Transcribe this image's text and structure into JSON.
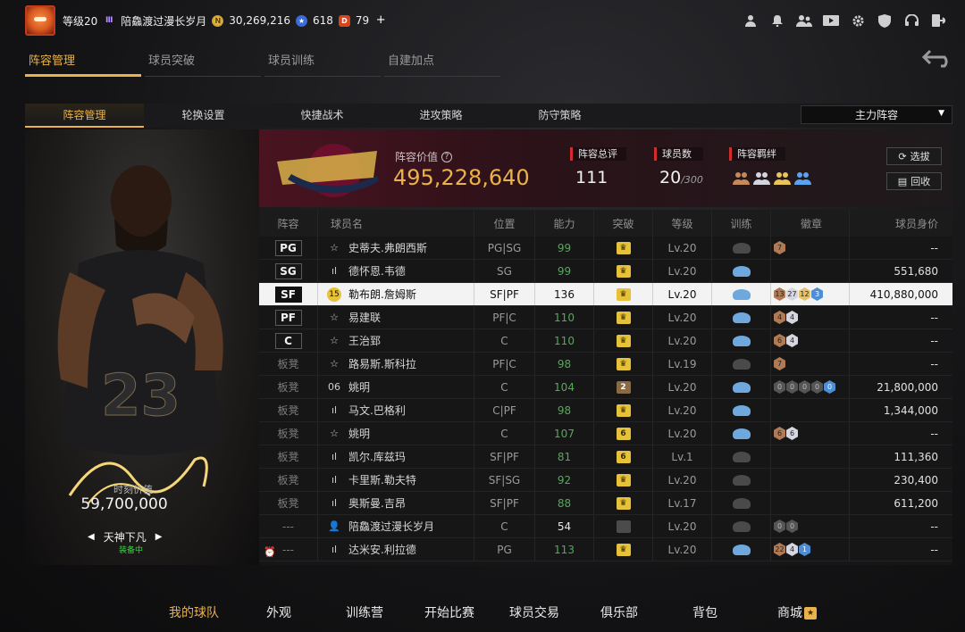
{
  "topbar": {
    "level": "等级20",
    "rank_icon": "Ⅲ",
    "player_name": "陪鱻渡过漫长岁月",
    "coins": "30,269,216",
    "stars": "618",
    "tickets": "79",
    "add_label": "+",
    "icons": [
      "user-icon",
      "bell-icon",
      "friends-icon",
      "video-icon",
      "gear-icon",
      "shield-icon",
      "headset-icon",
      "exit-icon"
    ]
  },
  "section_tabs": [
    {
      "label": "阵容管理",
      "active": true
    },
    {
      "label": "球员突破",
      "active": false
    },
    {
      "label": "球员训练",
      "active": false
    },
    {
      "label": "自建加点",
      "active": false
    }
  ],
  "sub_tabs": [
    {
      "label": "阵容管理",
      "active": true
    },
    {
      "label": "轮换设置",
      "active": false
    },
    {
      "label": "快捷战术",
      "active": false
    },
    {
      "label": "进攻策略",
      "active": false
    },
    {
      "label": "防守策略",
      "active": false
    }
  ],
  "lineup_select": {
    "value": "主力阵容"
  },
  "card": {
    "value_label": "时刻价值",
    "value": "59,700,000",
    "name": "天神下凡",
    "status": "装备中"
  },
  "team": {
    "logo_text": "CAVALIERS",
    "value_label": "阵容价值",
    "value": "495,228,640",
    "rating_label": "阵容总评",
    "rating": "111",
    "count_label": "球员数",
    "count": "20",
    "count_max": "/300",
    "bond_label": "阵容羁绊",
    "select_button": "选拔",
    "recycle_button": "回收"
  },
  "table": {
    "headers": {
      "pos": "阵容",
      "name": "球员名",
      "role": "位置",
      "ovr": "能力",
      "brk": "突破",
      "lv": "等级",
      "train": "训练",
      "badges": "徽章",
      "price": "球员身价"
    },
    "rows": [
      {
        "pos": "PG",
        "starter": true,
        "icon": "☆",
        "name": "史蒂夫.弗朗西斯",
        "role": "PG|SG",
        "ovr": "99",
        "brk": "gold",
        "lv": "Lv.20",
        "train": "gray",
        "badges": [
          [
            "bronze",
            "7"
          ]
        ],
        "price": "--"
      },
      {
        "pos": "SG",
        "starter": true,
        "icon": "ıl",
        "name": "德怀恩.韦德",
        "role": "SG",
        "ovr": "99",
        "brk": "gold",
        "lv": "Lv.20",
        "train": "blue",
        "badges": [],
        "price": "551,680"
      },
      {
        "pos": "SF",
        "starter": true,
        "icon": "15",
        "name": "勒布朗.詹姆斯",
        "role": "SF|PF",
        "ovr": "136",
        "brk": "gold",
        "lv": "Lv.20",
        "train": "blue",
        "badges": [
          [
            "bronze",
            "13"
          ],
          [
            "silver",
            "27"
          ],
          [
            "gold",
            "12"
          ],
          [
            "blue",
            "3"
          ]
        ],
        "price": "410,880,000",
        "selected": true
      },
      {
        "pos": "PF",
        "starter": true,
        "icon": "☆",
        "name": "易建联",
        "role": "PF|C",
        "ovr": "110",
        "brk": "gold",
        "lv": "Lv.20",
        "train": "blue",
        "badges": [
          [
            "bronze",
            "4"
          ],
          [
            "silver",
            "4"
          ]
        ],
        "price": "--"
      },
      {
        "pos": "C",
        "starter": true,
        "icon": "☆",
        "name": "王治郅",
        "role": "C",
        "ovr": "110",
        "brk": "gold",
        "lv": "Lv.20",
        "train": "blue",
        "badges": [
          [
            "bronze",
            "6"
          ],
          [
            "silver",
            "4"
          ]
        ],
        "price": "--"
      },
      {
        "pos": "板凳",
        "starter": false,
        "icon": "☆",
        "name": "路易斯.斯科拉",
        "role": "PF|C",
        "ovr": "98",
        "brk": "gold",
        "lv": "Lv.19",
        "train": "gray",
        "badges": [
          [
            "bronze",
            "7"
          ]
        ],
        "price": "--"
      },
      {
        "pos": "板凳",
        "starter": false,
        "icon": "06",
        "name": "姚明",
        "role": "C",
        "ovr": "104",
        "brk": "dark2",
        "lv": "Lv.20",
        "train": "blue",
        "badges": [
          [
            "dark",
            "0"
          ],
          [
            "dark",
            "0"
          ],
          [
            "dark",
            "0"
          ],
          [
            "dark",
            "0"
          ],
          [
            "blue",
            "0"
          ]
        ],
        "price": "21,800,000"
      },
      {
        "pos": "板凳",
        "starter": false,
        "icon": "ıl",
        "name": "马文.巴格利",
        "role": "C|PF",
        "ovr": "98",
        "brk": "gold",
        "lv": "Lv.20",
        "train": "blue",
        "badges": [],
        "price": "1,344,000"
      },
      {
        "pos": "板凳",
        "starter": false,
        "icon": "☆",
        "name": "姚明",
        "role": "C",
        "ovr": "107",
        "brk": "gold6",
        "lv": "Lv.20",
        "train": "blue",
        "badges": [
          [
            "bronze",
            "6"
          ],
          [
            "silver",
            "6"
          ]
        ],
        "price": "--"
      },
      {
        "pos": "板凳",
        "starter": false,
        "icon": "ıl",
        "name": "凯尔.库兹玛",
        "role": "SF|PF",
        "ovr": "81",
        "brk": "gold6",
        "lv": "Lv.1",
        "train": "gray",
        "badges": [],
        "price": "111,360"
      },
      {
        "pos": "板凳",
        "starter": false,
        "icon": "ıl",
        "name": "卡里斯.勒夫特",
        "role": "SF|SG",
        "ovr": "92",
        "brk": "gold",
        "lv": "Lv.20",
        "train": "gray",
        "badges": [],
        "price": "230,400"
      },
      {
        "pos": "板凳",
        "starter": false,
        "icon": "ıl",
        "name": "奥斯曼.吉昂",
        "role": "SF|PF",
        "ovr": "88",
        "brk": "gold",
        "lv": "Lv.17",
        "train": "gray",
        "badges": [],
        "price": "611,200"
      },
      {
        "pos": "---",
        "starter": false,
        "icon": "👤",
        "name": "陪鱻渡过漫长岁月",
        "role": "C",
        "ovr": "54",
        "brk": "gray",
        "lv": "Lv.20",
        "train": "gray",
        "badges": [
          [
            "dark",
            "0"
          ],
          [
            "dark",
            "0"
          ]
        ],
        "price": "--",
        "ovr_white": true
      },
      {
        "pos": "---",
        "starter": false,
        "icon": "ıl",
        "name": "达米安.利拉德",
        "role": "PG",
        "ovr": "113",
        "brk": "gold",
        "lv": "Lv.20",
        "train": "blue",
        "badges": [
          [
            "bronze",
            "22"
          ],
          [
            "silver",
            "4"
          ],
          [
            "blue",
            "1"
          ]
        ],
        "price": "--"
      }
    ]
  },
  "bottom_nav": [
    {
      "label": "我的球队",
      "active": true
    },
    {
      "label": "外观",
      "active": false
    },
    {
      "label": "训练营",
      "active": false
    },
    {
      "label": "开始比赛",
      "active": false
    },
    {
      "label": "球员交易",
      "active": false
    },
    {
      "label": "俱乐部",
      "active": false
    },
    {
      "label": "背包",
      "active": false
    },
    {
      "label": "商城",
      "active": false
    }
  ],
  "colors": {
    "accent": "#e9b24a",
    "green": "#4caf50",
    "red": "#d62b2b"
  }
}
